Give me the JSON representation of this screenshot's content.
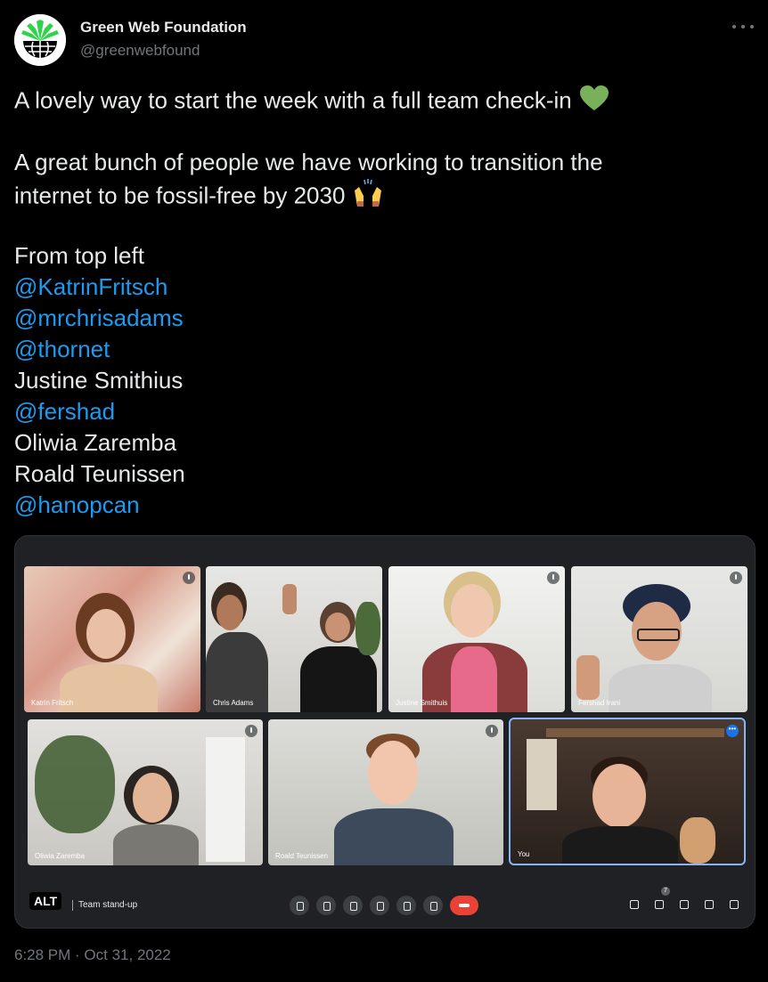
{
  "author": {
    "display_name": "Green Web Foundation",
    "handle": "@greenwebfound"
  },
  "tweet": {
    "line1": "A lovely way to start the week with a full team check-in",
    "line2": "A great bunch of people we have working to transition the",
    "line3": "internet to be fossil-free by 2030",
    "line4": "From top left",
    "people": [
      {
        "text": "@KatrinFritsch",
        "mention": true
      },
      {
        "text": "@mrchrisadams",
        "mention": true
      },
      {
        "text": "@thornet",
        "mention": true
      },
      {
        "text": "Justine Smithius",
        "mention": false
      },
      {
        "text": "@fershad",
        "mention": true
      },
      {
        "text": "Oliwia Zaremba",
        "mention": false
      },
      {
        "text": "Roald Teunissen",
        "mention": false
      },
      {
        "text": "@hanopcan",
        "mention": true
      }
    ],
    "emoji_1": "green-heart-icon",
    "emoji_2": "raising-hands-icon"
  },
  "media": {
    "alt_badge": "ALT",
    "meeting_title": "Team stand-up",
    "participants": [
      {
        "name": "Katrin Fritsch"
      },
      {
        "name": "Chris Adams"
      },
      {
        "name": "Justine Smithuis"
      },
      {
        "name": "Fershad Irani"
      },
      {
        "name": "Oliwia Zaremba"
      },
      {
        "name": "Roald Teunissen"
      },
      {
        "name": "You"
      }
    ],
    "people_count": "7",
    "colors": {
      "meet_bg": "#202124",
      "hangup": "#ea4335",
      "accent": "#1d9bf0"
    }
  },
  "timestamp": "6:28 PM · Oct 31, 2022"
}
